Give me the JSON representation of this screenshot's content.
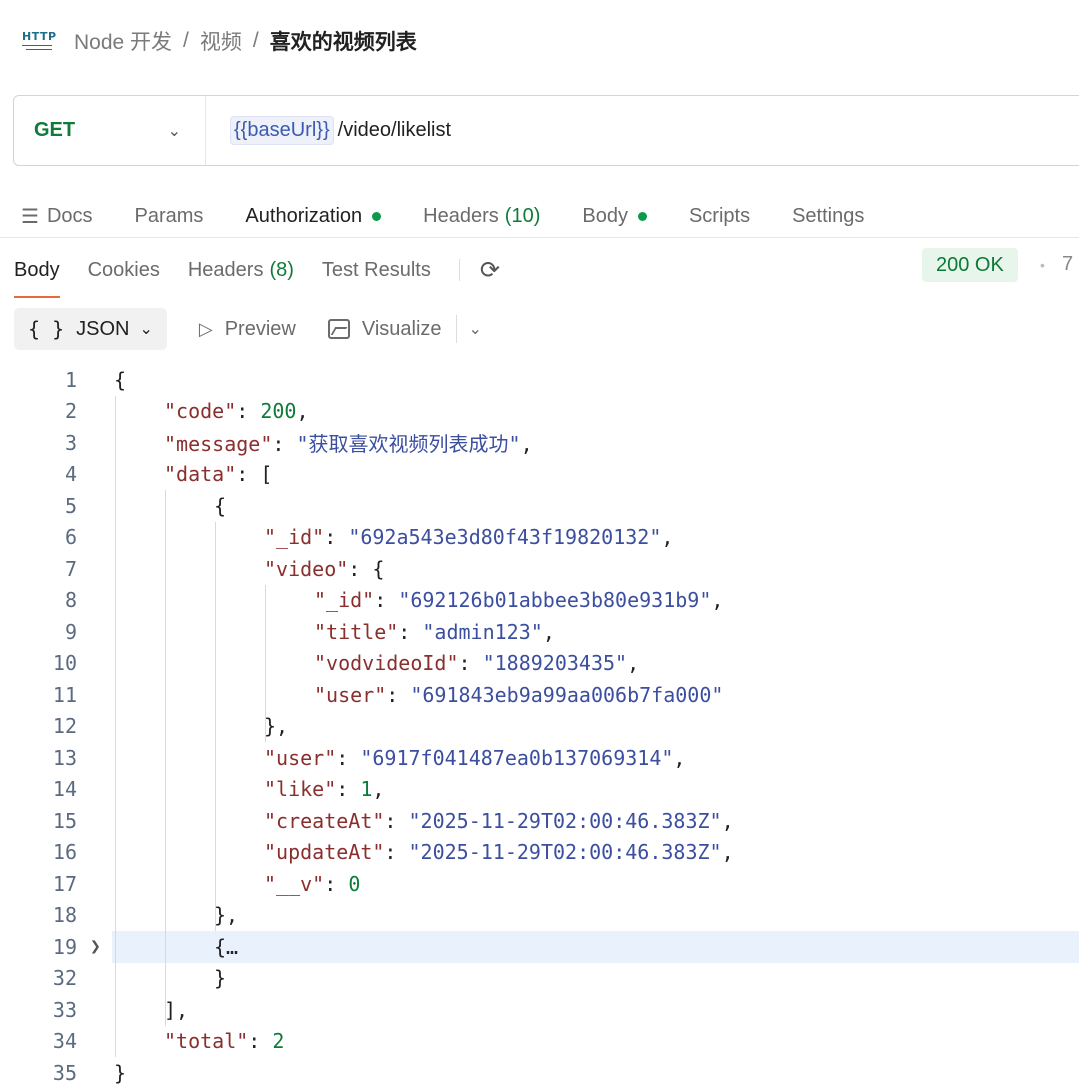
{
  "breadcrumb": {
    "icon": "http-icon",
    "items": [
      "Node 开发",
      "视频",
      "喜欢的视频列表"
    ]
  },
  "request": {
    "method": "GET",
    "url_variable": "{{baseUrl}}",
    "url_path": "/video/likelist"
  },
  "request_tabs": [
    {
      "label": "Docs"
    },
    {
      "label": "Params"
    },
    {
      "label": "Authorization",
      "dot": true
    },
    {
      "label": "Headers",
      "count": "(10)"
    },
    {
      "label": "Body",
      "dot": true
    },
    {
      "label": "Scripts"
    },
    {
      "label": "Settings"
    }
  ],
  "response_tabs": {
    "body": "Body",
    "cookies": "Cookies",
    "headers": "Headers",
    "headers_count": "(8)",
    "test_results": "Test Results"
  },
  "status": {
    "text": "200 OK",
    "color": "#0a7a36",
    "size_partial": "7"
  },
  "format_bar": {
    "json": "JSON",
    "preview": "Preview",
    "visualize": "Visualize"
  },
  "code_lines": [
    {
      "n": "1",
      "t": "{"
    },
    {
      "n": "2",
      "t": "\"code\": 200,"
    },
    {
      "n": "3",
      "t": "\"message\": \"获取喜欢视频列表成功\","
    },
    {
      "n": "4",
      "t": "\"data\": ["
    },
    {
      "n": "5",
      "t": "{"
    },
    {
      "n": "6",
      "t": "\"_id\": \"692a543e3d80f43f19820132\","
    },
    {
      "n": "7",
      "t": "\"video\": {"
    },
    {
      "n": "8",
      "t": "\"_id\": \"692126b01abbee3b80e931b9\","
    },
    {
      "n": "9",
      "t": "\"title\": \"admin123\","
    },
    {
      "n": "10",
      "t": "\"vodvideoId\": \"1889203435\","
    },
    {
      "n": "11",
      "t": "\"user\": \"691843eb9a99aa006b7fa000\""
    },
    {
      "n": "12",
      "t": "},"
    },
    {
      "n": "13",
      "t": "\"user\": \"6917f041487ea0b137069314\","
    },
    {
      "n": "14",
      "t": "\"like\": 1,"
    },
    {
      "n": "15",
      "t": "\"createAt\": \"2025-11-29T02:00:46.383Z\","
    },
    {
      "n": "16",
      "t": "\"updateAt\": \"2025-11-29T02:00:46.383Z\","
    },
    {
      "n": "17",
      "t": "\"__v\": 0"
    },
    {
      "n": "18",
      "t": "},"
    },
    {
      "n": "19",
      "t": "{…",
      "folded": true
    },
    {
      "n": "32",
      "t": "}"
    },
    {
      "n": "33",
      "t": "],"
    },
    {
      "n": "34",
      "t": "\"total\": 2"
    },
    {
      "n": "35",
      "t": "}"
    }
  ]
}
